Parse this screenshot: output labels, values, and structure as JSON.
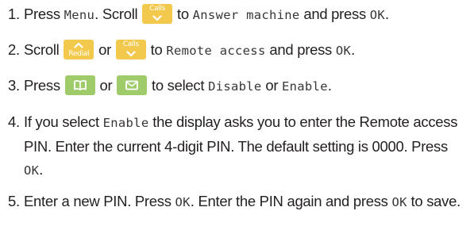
{
  "steps": [
    {
      "number": "1.",
      "text_a": "Press ",
      "lcd_menu": "Menu",
      "text_b": ". Scroll ",
      "key_calls_label": "Calls",
      "text_c": " to ",
      "lcd_answer": "Answer machine",
      "text_d": " and press ",
      "lcd_ok": "OK",
      "text_e": "."
    },
    {
      "number": "2.",
      "text_a": "Scroll ",
      "key_redial_label": "Redial",
      "text_or": " or ",
      "key_calls_label": "Calls",
      "text_to": " to ",
      "lcd_remote": "Remote access",
      "text_d": " and press ",
      "lcd_ok": "OK",
      "text_e": "."
    },
    {
      "number": "3.",
      "text_a": "Press ",
      "key_left_icon": "phonebook-icon",
      "text_or": " or ",
      "key_right_icon": "envelope-icon",
      "text_b": " to select ",
      "lcd_disable": "Disable",
      "text_c": " or ",
      "lcd_enable": "Enable",
      "text_d": "."
    },
    {
      "number": "4.",
      "text_a": "If you select ",
      "lcd_enable": "Enable",
      "text_b": " the display asks you to enter the Remote access PIN. Enter the current 4-digit PIN. The default setting is 0000. Press ",
      "lcd_ok": "OK",
      "text_c": "."
    },
    {
      "number": "5.",
      "text_a": "Enter a new PIN. Press ",
      "lcd_ok": "OK",
      "text_b": ". Enter the PIN again and press ",
      "lcd_ok2": "OK",
      "text_c": " to save."
    }
  ],
  "colors": {
    "text": "#231f20",
    "key_yellow": "#f2c94c",
    "key_green": "#9fcb6b",
    "key_glyph": "#ffffff"
  }
}
